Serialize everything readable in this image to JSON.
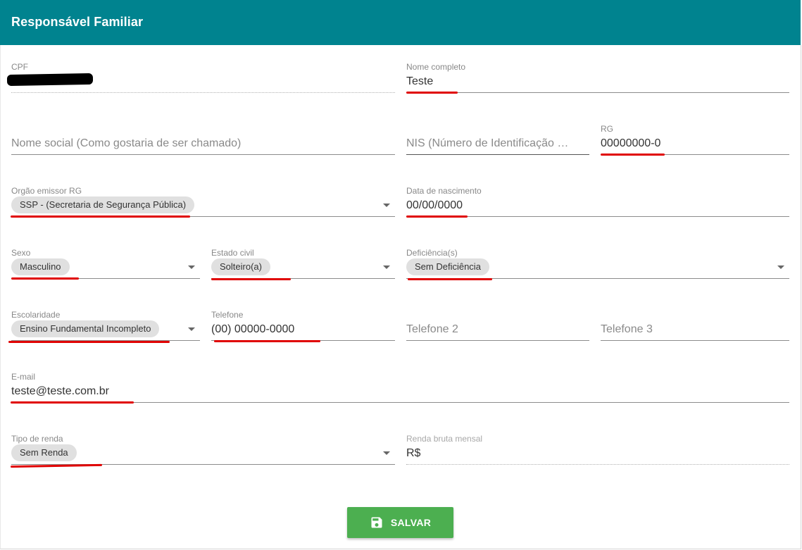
{
  "header": {
    "title": "Responsável Familiar"
  },
  "fields": {
    "cpf": {
      "label": "CPF",
      "value": ""
    },
    "nome_completo": {
      "label": "Nome completo",
      "value": "Teste"
    },
    "nome_social": {
      "placeholder": "Nome social (Como gostaria de ser chamado)"
    },
    "nis": {
      "placeholder": "NIS (Número de Identificação Social)"
    },
    "rg": {
      "label": "RG",
      "value": "00000000-0"
    },
    "orgao_emissor": {
      "label": "Orgão emissor RG",
      "value": "SSP - (Secretaria de Segurança Pública)"
    },
    "data_nascimento": {
      "label": "Data de nascimento",
      "value": "00/00/0000"
    },
    "sexo": {
      "label": "Sexo",
      "value": "Masculino"
    },
    "estado_civil": {
      "label": "Estado civil",
      "value": "Solteiro(a)"
    },
    "deficiencia": {
      "label": "Deficiência(s)",
      "value": "Sem Deficiência"
    },
    "escolaridade": {
      "label": "Escolaridade",
      "value": "Ensino Fundamental Incompleto"
    },
    "telefone": {
      "label": "Telefone",
      "value": "(00) 00000-0000"
    },
    "telefone2": {
      "placeholder": "Telefone 2"
    },
    "telefone3": {
      "placeholder": "Telefone 3"
    },
    "email": {
      "label": "E-mail",
      "value": "teste@teste.com.br"
    },
    "tipo_renda": {
      "label": "Tipo de renda",
      "value": "Sem Renda"
    },
    "renda_bruta": {
      "label": "Renda bruta mensal",
      "value": "R$"
    }
  },
  "actions": {
    "save_label": "SALVAR",
    "save_icon": "floppy-disk-icon"
  },
  "colors": {
    "header": "#00838f",
    "save_button": "#4caf50",
    "annotation": "#e00000"
  }
}
